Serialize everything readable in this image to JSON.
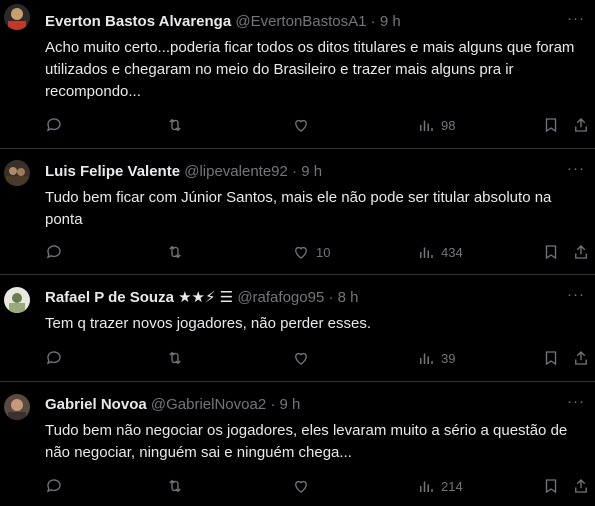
{
  "tweets": [
    {
      "name": "Everton Bastos Alvarenga",
      "handle": "@EvertonBastosA1",
      "dot": "·",
      "time": "9 h",
      "text": "Acho muito certo...poderia ficar todos os ditos titulares e mais alguns que foram utilizados e chegaram no meio do Brasileiro e trazer mais alguns pra ir recompondo...",
      "likes": "",
      "views": "98",
      "avatar_color": "#c0392b"
    },
    {
      "name": "Luis Felipe Valente",
      "handle": "@lipevalente92",
      "dot": "·",
      "time": "9 h",
      "text": "Tudo bem ficar com Júnior Santos, mais ele não pode ser titular absoluto na ponta",
      "likes": "10",
      "views": "434",
      "avatar_color": "#5a4a3a"
    },
    {
      "name": "Rafael P de Souza",
      "name_badges": "★★⚡ ☰",
      "handle": "@rafafogo95",
      "dot": "·",
      "time": "8 h",
      "text": "Tem q trazer novos jogadores, não perder esses.",
      "likes": "",
      "views": "39",
      "avatar_color": "#8a9a6a"
    },
    {
      "name": "Gabriel Novoa",
      "handle": "@GabrielNovoa2",
      "dot": "·",
      "time": "9 h",
      "text": "Tudo bem não negociar os jogadores, eles levaram muito a sério a questão de não negociar, ninguém sai e ninguém chega...",
      "likes": "",
      "views": "214",
      "avatar_color": "#7a6a5a"
    }
  ],
  "more_label": "···",
  "icons": [
    "reply-icon",
    "retweet-icon",
    "like-icon",
    "views-icon",
    "bookmark-icon",
    "share-icon"
  ],
  "colors": {
    "background": "#000000",
    "text": "#e7e9ea",
    "muted": "#71767b",
    "divider": "#2f3336"
  }
}
